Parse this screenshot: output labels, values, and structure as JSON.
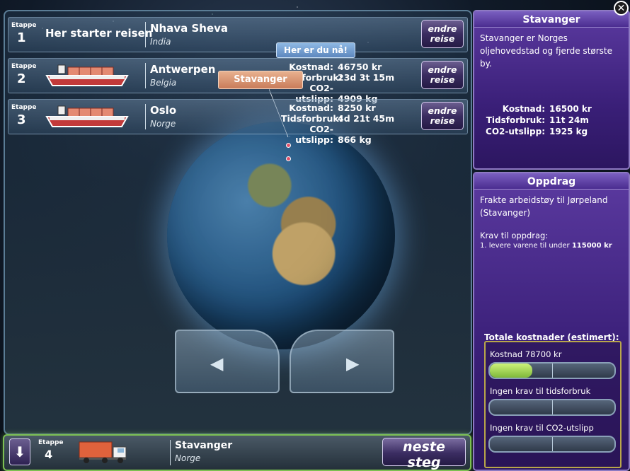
{
  "routes": [
    {
      "etappe_label": "Etappe",
      "number": "1",
      "start_text": "Her starter reisen",
      "city": "Nhava Sheva",
      "country": "India",
      "button_label": "endre reise"
    },
    {
      "etappe_label": "Etappe",
      "number": "2",
      "city": "Antwerpen",
      "country": "Belgia",
      "stats": {
        "cost_label": "Kostnad:",
        "cost": "46750 kr",
        "time_label": "Tidsforbruk:",
        "time": "23d 3t 15m",
        "co2_label": "CO2-utslipp:",
        "co2": "4909 kg"
      },
      "button_label": "endre reise"
    },
    {
      "etappe_label": "Etappe",
      "number": "3",
      "city": "Oslo",
      "country": "Norge",
      "stats": {
        "cost_label": "Kostnad:",
        "cost": "8250 kr",
        "time_label": "Tidsforbruk:",
        "time": "4d 21t 45m",
        "co2_label": "CO2-utslipp:",
        "co2": "866 kg"
      },
      "button_label": "endre reise"
    }
  ],
  "map": {
    "here_label": "Her er du nå!",
    "destination_label": "Stavanger"
  },
  "nav": {
    "prev_icon": "triangle-left-icon",
    "next_icon": "triangle-right-icon"
  },
  "current": {
    "etappe_label": "Etappe",
    "number": "4",
    "city": "Stavanger",
    "country": "Norge",
    "next_label": "neste steg"
  },
  "city_info": {
    "title": "Stavanger",
    "description": "Stavanger er Norges oljehovedstad og fjerde største by.",
    "cost_label": "Kostnad:",
    "cost": "16500 kr",
    "time_label": "Tidsforbruk:",
    "time": "11t 24m",
    "co2_label": "CO2-utslipp:",
    "co2": "1925 kg"
  },
  "mission": {
    "title": "Oppdrag",
    "description": "Frakte arbeidstøy til Jørpeland (Stavanger)",
    "requirements_title": "Krav til oppdrag:",
    "requirement_1_prefix": "1. levere varene til under",
    "requirement_1_value": "115000 kr"
  },
  "totals": {
    "heading": "Totale kostnader (estimert):",
    "cost_label": "Kostnad 78700 kr",
    "cost_fraction": 0.34,
    "time_label": "Ingen krav til tidsforbruk",
    "time_fraction": 0,
    "co2_label": "Ingen krav til CO2-utslipp",
    "co2_fraction": 0
  },
  "colors": {
    "accent_purple": "#4b2d90",
    "progress_green": "#9fd44f",
    "highlight_green": "#7cbf52"
  }
}
